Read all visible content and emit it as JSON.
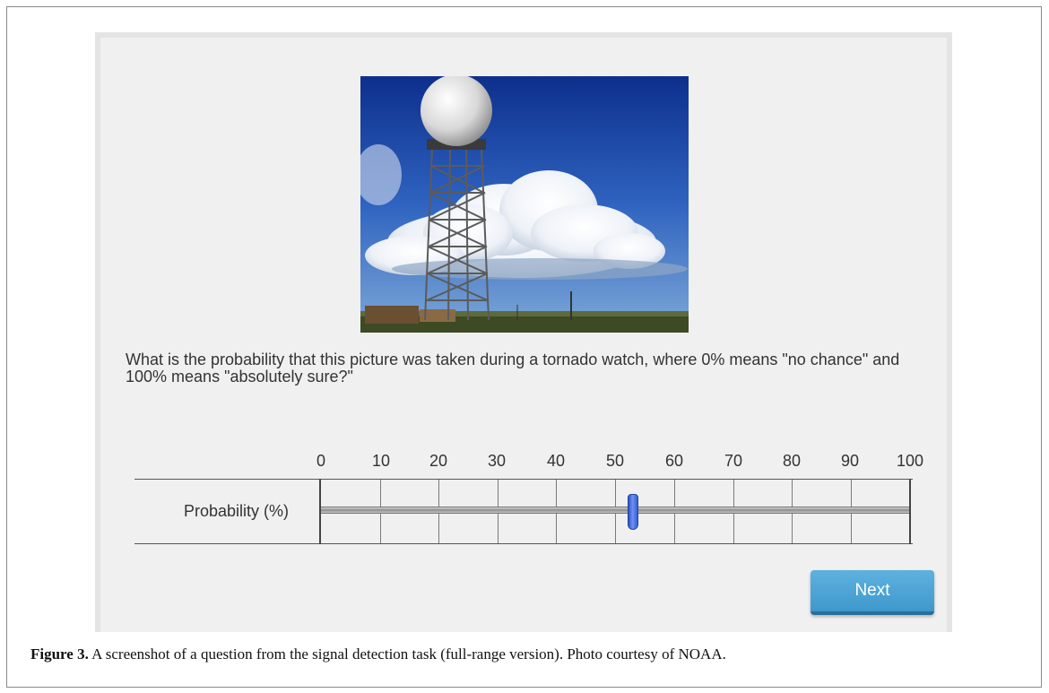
{
  "question": {
    "text": "What is the probability that this picture was taken during a tornado watch, where 0% means \"no chance\" and 100% means \"absolutely sure?\""
  },
  "photo": {
    "subject": "weather radar tower with dome and cumulus cloud"
  },
  "slider": {
    "row_label": "Probability (%)",
    "ticks": [
      "0",
      "10",
      "20",
      "30",
      "40",
      "50",
      "60",
      "70",
      "80",
      "90",
      "100"
    ],
    "min": 0,
    "max": 100,
    "value": 53
  },
  "buttons": {
    "next_label": "Next"
  },
  "caption": {
    "label": "Figure 3.",
    "text": " A screenshot of a question from the signal detection task (full-range version). Photo courtesy of NOAA."
  },
  "colors": {
    "panel_bg": "#f0f0f0",
    "button": "#4ba3d5",
    "thumb": "#3f66dd"
  }
}
